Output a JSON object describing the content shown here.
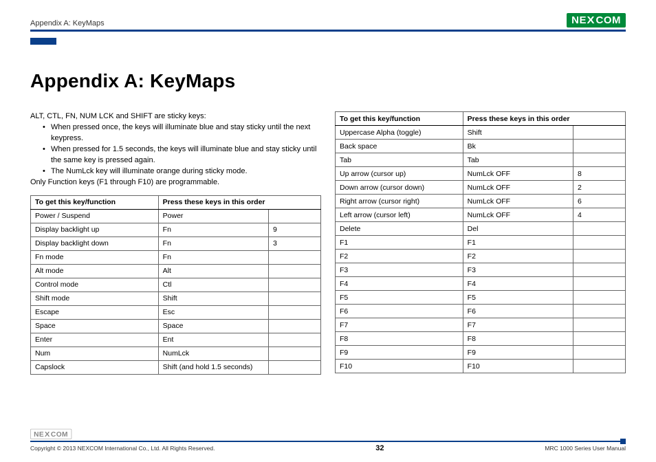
{
  "header": {
    "section_label": "Appendix A: KeyMaps",
    "logo_text_1": "NE",
    "logo_text_x": "X",
    "logo_text_2": "COM"
  },
  "title": "Appendix A: KeyMaps",
  "intro": {
    "leadin": "ALT, CTL, FN, NUM LCK and SHIFT are sticky keys:",
    "bullet1": "When pressed once, the keys will illuminate blue and stay sticky until the next keypress.",
    "bullet2": "When pressed for 1.5 seconds, the keys will illuminate blue and stay sticky until the same key is pressed again.",
    "bullet3": "The NumLck key will illuminate orange during sticky mode.",
    "tail": "Only Function keys (F1 through F10) are programmable."
  },
  "table_headers": {
    "h1": "To get this key/function",
    "h2": "Press these keys in this order"
  },
  "left_table": [
    {
      "fn": "Power / Suspend",
      "k1": "Power",
      "k2": ""
    },
    {
      "fn": "Display backlight up",
      "k1": "Fn",
      "k2": "9"
    },
    {
      "fn": "Display backlight down",
      "k1": "Fn",
      "k2": "3"
    },
    {
      "fn": "Fn mode",
      "k1": "Fn",
      "k2": ""
    },
    {
      "fn": "Alt mode",
      "k1": "Alt",
      "k2": ""
    },
    {
      "fn": "Control mode",
      "k1": "Ctl",
      "k2": ""
    },
    {
      "fn": "Shift mode",
      "k1": "Shift",
      "k2": ""
    },
    {
      "fn": "Escape",
      "k1": "Esc",
      "k2": ""
    },
    {
      "fn": "Space",
      "k1": "Space",
      "k2": ""
    },
    {
      "fn": "Enter",
      "k1": "Ent",
      "k2": ""
    },
    {
      "fn": "Num",
      "k1": "NumLck",
      "k2": ""
    },
    {
      "fn": "Capslock",
      "k1": "Shift (and hold 1.5 seconds)",
      "k2": ""
    }
  ],
  "right_table": [
    {
      "fn": "Uppercase Alpha (toggle)",
      "k1": "Shift",
      "k2": ""
    },
    {
      "fn": "Back space",
      "k1": "Bk",
      "k2": ""
    },
    {
      "fn": "Tab",
      "k1": "Tab",
      "k2": ""
    },
    {
      "fn": "Up arrow (cursor up)",
      "k1": "NumLck OFF",
      "k2": "8"
    },
    {
      "fn": "Down arrow (cursor down)",
      "k1": "NumLck OFF",
      "k2": "2"
    },
    {
      "fn": "Right arrow (cursor right)",
      "k1": "NumLck OFF",
      "k2": "6"
    },
    {
      "fn": "Left arrow (cursor left)",
      "k1": "NumLck OFF",
      "k2": "4"
    },
    {
      "fn": "Delete",
      "k1": "Del",
      "k2": ""
    },
    {
      "fn": "F1",
      "k1": "F1",
      "k2": ""
    },
    {
      "fn": "F2",
      "k1": "F2",
      "k2": ""
    },
    {
      "fn": "F3",
      "k1": "F3",
      "k2": ""
    },
    {
      "fn": "F4",
      "k1": "F4",
      "k2": ""
    },
    {
      "fn": "F5",
      "k1": "F5",
      "k2": ""
    },
    {
      "fn": "F6",
      "k1": "F6",
      "k2": ""
    },
    {
      "fn": "F7",
      "k1": "F7",
      "k2": ""
    },
    {
      "fn": "F8",
      "k1": "F8",
      "k2": ""
    },
    {
      "fn": "F9",
      "k1": "F9",
      "k2": ""
    },
    {
      "fn": "F10",
      "k1": "F10",
      "k2": ""
    }
  ],
  "footer": {
    "copyright": "Copyright © 2013 NEXCOM International Co., Ltd. All Rights Reserved.",
    "page": "32",
    "manual": "MRC 1000 Series User Manual"
  }
}
